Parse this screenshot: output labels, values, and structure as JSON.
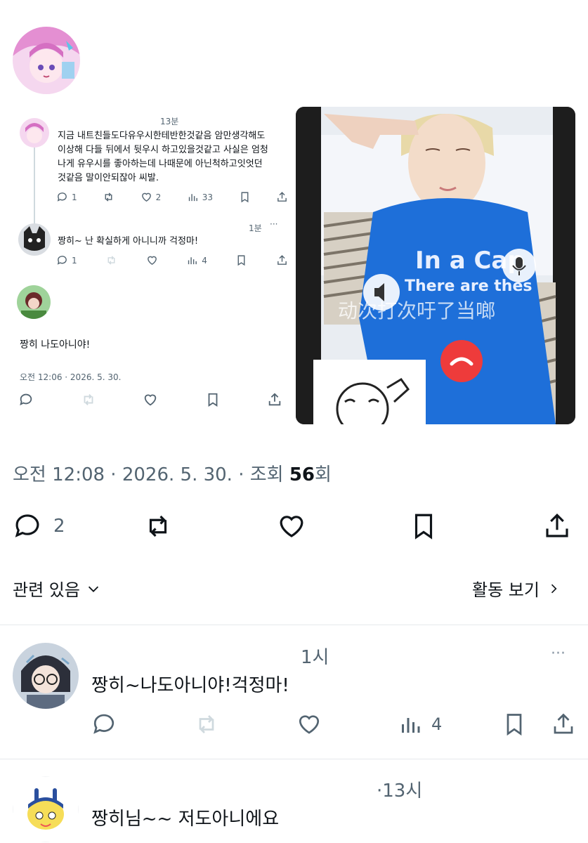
{
  "post": {
    "avatar_icon": "anime-girl-avatar",
    "meta_time": "오전 12:08 · 2026. 5. 30. · 조회 ",
    "meta_views": "56",
    "meta_suffix": "회",
    "replies_count": "2"
  },
  "embed": {
    "tweet1": {
      "time": "13분",
      "text_lines": [
        "지금 내트친들도다유우시한테반한것같음 암만생각해도",
        "이상해 다들 뒤에서 뒷우시 하고있을것같고 사실은 엄청",
        "나게 유우시를 좋아하는데 나때문에 아닌척하고잇엇던",
        "것같음 말이안되잖아 씨발."
      ],
      "replies": "1",
      "likes": "2",
      "views": "33"
    },
    "tweet2": {
      "time": "1분",
      "text": "짱히~ 난 확실하게 아니니까 걱정마!",
      "replies": "1",
      "views": "4"
    },
    "tweet3": {
      "text": "짱히 나도아니야!",
      "timestamp": "오전 12:06 · 2026. 5. 30."
    }
  },
  "photo": {
    "shirt_text_1": "In a Cap",
    "shirt_text_2": "There are thes",
    "overlay_text": "动次打次吁了当啷"
  },
  "related": {
    "label": "관련 있음",
    "activity_label": "활동 보기"
  },
  "replies": [
    {
      "time": "1시",
      "text": "짱히~나도아니야!걱정마!",
      "views": "4",
      "avatar_icon": "glasses-girl-avatar"
    },
    {
      "time": "·13시",
      "text": "짱히님~~ 저도아니에요",
      "avatar_icon": "tamagotchi-avatar"
    }
  ],
  "colors": {
    "muted": "#536471",
    "text": "#0f1419",
    "divider": "#e6e9ec",
    "shirt_blue": "#1e6fd9"
  }
}
